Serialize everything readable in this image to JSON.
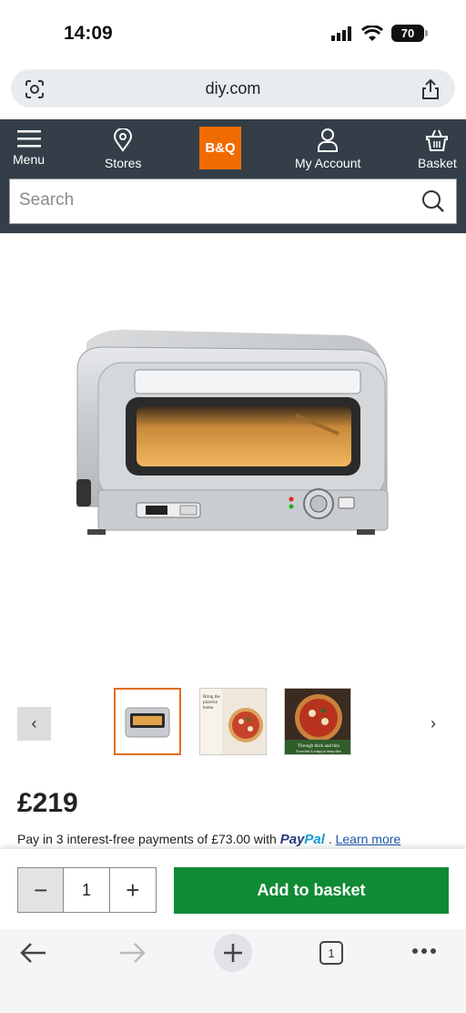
{
  "status_bar": {
    "time": "14:09",
    "battery": "70"
  },
  "browser": {
    "url": "diy.com"
  },
  "nav": {
    "menu_label": "Menu",
    "stores_label": "Stores",
    "logo_text": "B&Q",
    "account_label": "My Account",
    "basket_label": "Basket"
  },
  "search": {
    "placeholder": "Search"
  },
  "product": {
    "price": "£219",
    "paypal_text": "Pay in 3 interest-free payments of £73.00 with",
    "paypal_logo_a": "Pay",
    "paypal_logo_b": "Pal",
    "paypal_sep": " .",
    "learn_more": "Learn more",
    "thumb2_caption": "Bring the pizzeria home",
    "thumb3_caption": "Through thick and thin",
    "thumb3_sub": "From thin & crispy to deep dish"
  },
  "cart": {
    "qty": "1",
    "add_label": "Add to basket"
  },
  "tabs": {
    "count": "1"
  },
  "colors": {
    "brand": "#f06c00",
    "nav_bg": "#333e48",
    "cta": "#108a35"
  }
}
